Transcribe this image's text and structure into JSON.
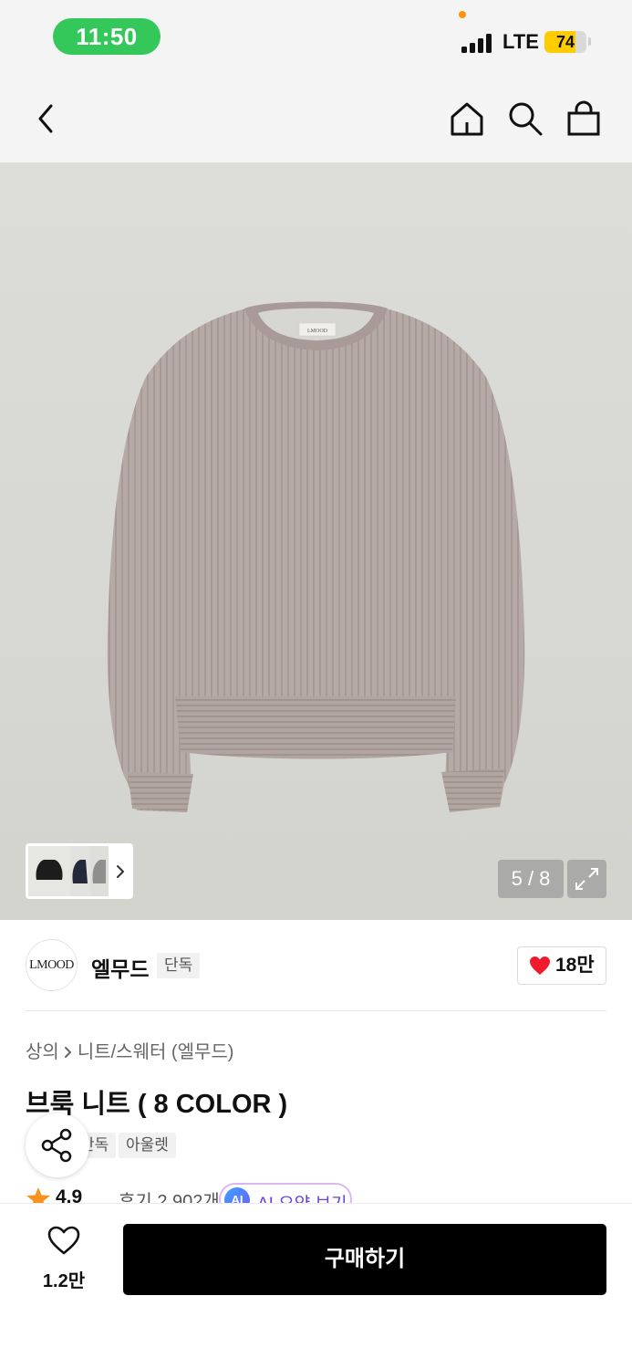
{
  "status_bar": {
    "time": "11:50",
    "network": "LTE",
    "battery_level": 74,
    "battery_text": "74",
    "time_pill_color": "#34c759",
    "battery_color": "#ffcc00"
  },
  "nav": {
    "back_icon": "chevron-left-icon",
    "home_icon": "home-icon",
    "search_icon": "search-icon",
    "bag_icon": "shopping-bag-icon"
  },
  "gallery": {
    "counter": "5 / 8",
    "current_index": 5,
    "total": 8,
    "product_color": "#b4a7a3",
    "thumbnail_colors": [
      "#1c1c1c",
      "#23293b",
      "#8f8f8f"
    ],
    "thumbnail_more_icon": "chevron-right-icon",
    "expand_icon": "expand-icon"
  },
  "brand": {
    "logo_text": "LMOOD",
    "name": "엘무드",
    "tag": "단독",
    "like_count": "18만",
    "like_icon": "heart-filled-icon",
    "like_color": "#ee1c2c"
  },
  "breadcrumb": {
    "category": "상의",
    "subcategory": "니트/스웨터 (엘무드)"
  },
  "product": {
    "title": "브룩 니트 ( 8 COLOR )",
    "tags": [
      "단독",
      "아울렛"
    ]
  },
  "rating": {
    "score": "4.9",
    "reviews": "후기 2,902개",
    "ai_badge": "AI",
    "ai_label": "AI 요약 보기",
    "star_color": "#f7931e"
  },
  "share": {
    "icon": "share-icon"
  },
  "bottom_bar": {
    "wish_icon": "heart-outline-icon",
    "wish_count": "1.2만",
    "buy_label": "구매하기"
  }
}
